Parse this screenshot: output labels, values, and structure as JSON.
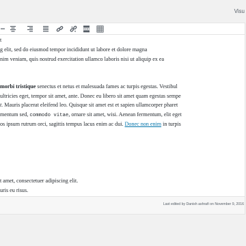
{
  "tabs": {
    "visual": "Visu"
  },
  "toolbar": {
    "buttons": [
      "align-left-icon",
      "align-center-icon",
      "align-right-icon",
      "link-icon",
      "unlink-icon",
      "read-more-icon",
      "toolbar-toggle-icon"
    ]
  },
  "content": {
    "p1_lines": [
      "t",
      "g elit, sed do eiusmod tempor incididunt ut labore et dolore magna",
      "nim veniam, quis nostrud exercitation ullamco laboris nisi ut aliquip ex ea"
    ],
    "p2": {
      "bold": "morbi tristique",
      "line1_rest": " senectus et netus et malesuada fames ac turpis egestas. Vestibul",
      "line2": "ultricies eget, tempor sit amet, ante. Donec eu libero sit amet quam egestas sempe",
      "line3_em": "t.",
      "line3_rest": " Mauris placerat eleifend leo. Quisque sit amet est et sapien ullamcorper pharet",
      "line4_a": "mentum sed, ",
      "line4_code": "commodo vitae",
      "line4_b": ", ornare sit amet, wisi. Aenean fermentum, elit eget",
      "line5_a": "os ipsum rutrum orci, sagittis tempus lacus enim ac dui. ",
      "line5_link": "Donec non enim",
      "line5_b": " in turpis"
    },
    "p3_lines": [
      "t amet, consectetuer adipiscing elit.",
      "uris eu risus."
    ]
  },
  "status": {
    "last_edited": "Last edited by Danish ashrafi on November 9, 2016"
  }
}
